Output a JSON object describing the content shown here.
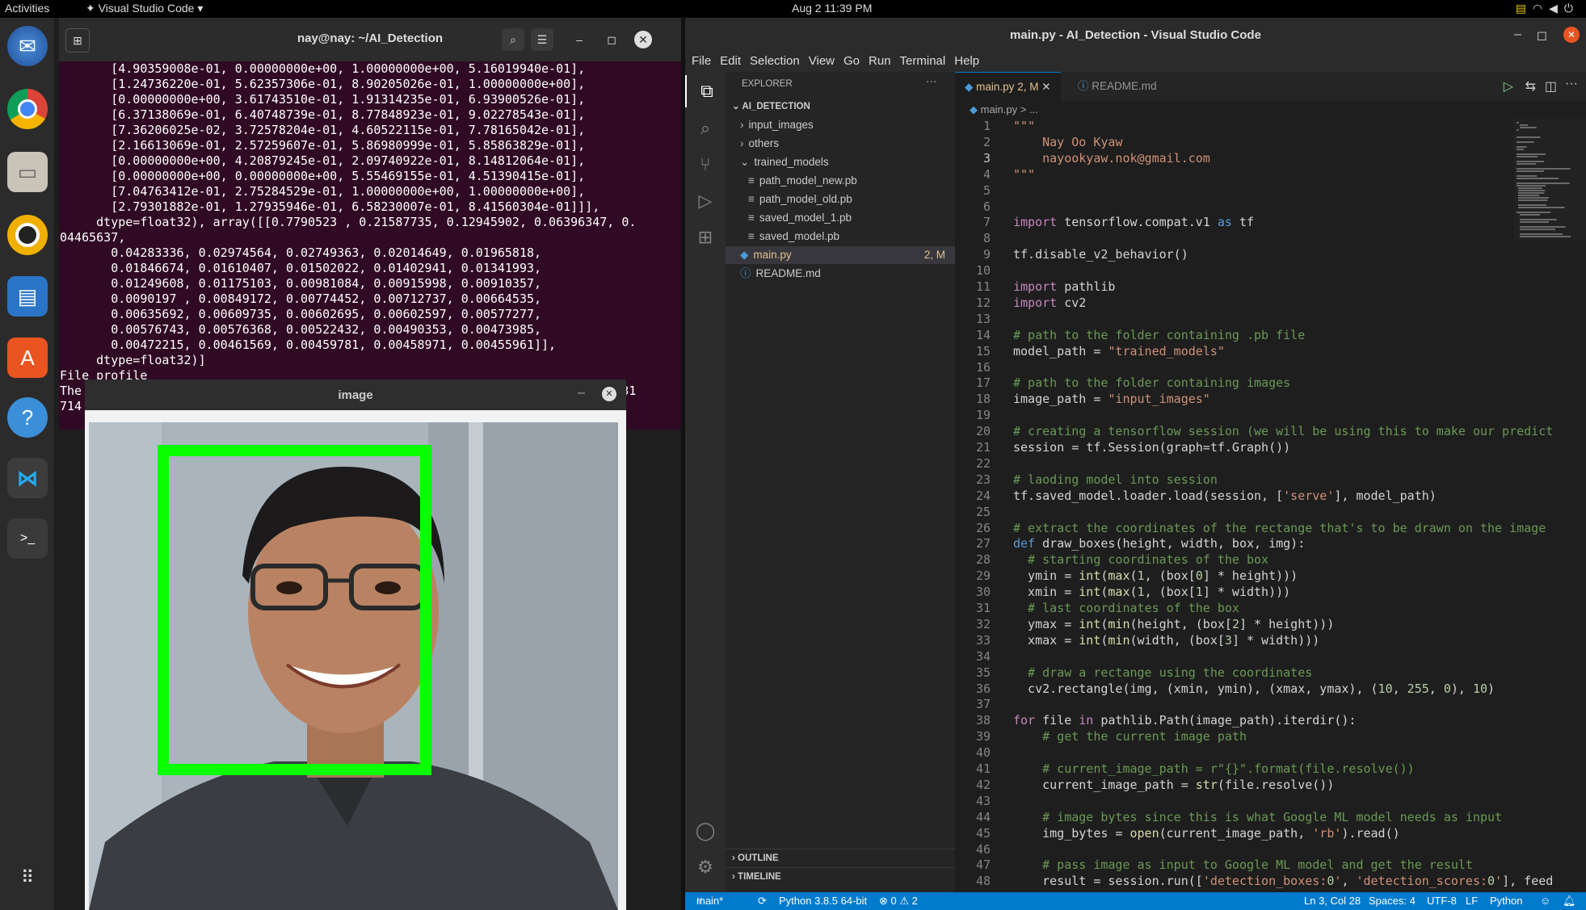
{
  "topbar": {
    "activities": "Activities",
    "app_name": "Visual Studio Code",
    "clock": "Aug 2  11:39 PM"
  },
  "terminal": {
    "title": "nay@nay: ~/AI_Detection",
    "lines": [
      "       [4.90359008e-01, 0.00000000e+00, 1.00000000e+00, 5.16019940e-01],",
      "       [1.24736220e-01, 5.62357306e-01, 8.90205026e-01, 1.00000000e+00],",
      "       [0.00000000e+00, 3.61743510e-01, 1.91314235e-01, 6.93900526e-01],",
      "       [6.37138069e-01, 6.40748739e-01, 8.77848923e-01, 9.02278543e-01],",
      "       [7.36206025e-02, 3.72578204e-01, 4.60522115e-01, 7.78165042e-01],",
      "       [2.16613069e-01, 2.57259607e-01, 5.86980999e-01, 5.85863829e-01],",
      "       [0.00000000e+00, 4.20879245e-01, 2.09740922e-01, 8.14812064e-01],",
      "       [0.00000000e+00, 0.00000000e+00, 5.55469155e-01, 4.51390415e-01],",
      "       [7.04763412e-01, 2.75284529e-01, 1.00000000e+00, 1.00000000e+00],",
      "       [2.79301882e-01, 1.27935946e-01, 6.58230007e-01, 8.41560304e-01]]],",
      "     dtype=float32), array([[0.7790523 , 0.21587735, 0.12945902, 0.06396347, 0.",
      "04465637,",
      "       0.04283336, 0.02974564, 0.02749363, 0.02014649, 0.01965818,",
      "       0.01846674, 0.01610407, 0.01502022, 0.01402941, 0.01341993,",
      "       0.01249608, 0.01175103, 0.00981084, 0.00915998, 0.00910357,",
      "       0.0090197 , 0.00849172, 0.00774452, 0.00712737, 0.00664535,",
      "       0.00635692, 0.00609735, 0.00602695, 0.00602597, 0.00577277,",
      "       0.00576743, 0.00576368, 0.00522432, 0.00490353, 0.00473985,",
      "       0.00472215, 0.00461569, 0.00459781, 0.00458971, 0.00455961]],",
      "     dtype=float32)]",
      "File profile",
      "The                                                                       05231",
      "714"
    ]
  },
  "image_window": {
    "title": "image"
  },
  "vscode": {
    "title": "main.py - AI_Detection - Visual Studio Code",
    "menu": [
      "File",
      "Edit",
      "Selection",
      "View",
      "Go",
      "Run",
      "Terminal",
      "Help"
    ],
    "explorer_label": "EXPLORER",
    "root": "AI_DETECTION",
    "tree": [
      {
        "label": "input_images",
        "kind": "folder",
        "badge": ""
      },
      {
        "label": "others",
        "kind": "folder",
        "badge": ""
      },
      {
        "label": "trained_models",
        "kind": "folder-open",
        "badge": ""
      },
      {
        "label": "path_model_new.pb",
        "kind": "file",
        "badge": ""
      },
      {
        "label": "path_model_old.pb",
        "kind": "file",
        "badge": ""
      },
      {
        "label": "saved_model_1.pb",
        "kind": "file",
        "badge": ""
      },
      {
        "label": "saved_model.pb",
        "kind": "file",
        "badge": ""
      },
      {
        "label": "main.py",
        "kind": "py",
        "badge": "2, M"
      },
      {
        "label": "README.md",
        "kind": "info",
        "badge": ""
      }
    ],
    "outline": "OUTLINE",
    "timeline": "TIMELINE",
    "tabs": [
      {
        "label": "main.py",
        "badge": "2, M"
      },
      {
        "label": "README.md",
        "badge": ""
      }
    ],
    "breadcrumb": "main.py > ...",
    "code": [
      "\"\"\"",
      "    Nay Oo Kyaw",
      "    nayookyaw.nok@gmail.com",
      "\"\"\"",
      "",
      "",
      "import tensorflow.compat.v1 as tf",
      "",
      "tf.disable_v2_behavior()",
      "",
      "import pathlib",
      "import cv2",
      "",
      "# path to the folder containing .pb file",
      "model_path = \"trained_models\"",
      "",
      "# path to the folder containing images",
      "image_path = \"input_images\"",
      "",
      "# creating a tensorflow session (we will be using this to make our predict",
      "session = tf.Session(graph=tf.Graph())",
      "",
      "# laoding model into session",
      "tf.saved_model.loader.load(session, ['serve'], model_path)",
      "",
      "# extract the coordinates of the rectange that's to be drawn on the image",
      "def draw_boxes(height, width, box, img):",
      "  # starting coordinates of the box",
      "  ymin = int(max(1, (box[0] * height)))",
      "  xmin = int(max(1, (box[1] * width)))",
      "  # last coordinates of the box",
      "  ymax = int(min(height, (box[2] * height)))",
      "  xmax = int(min(width, (box[3] * width)))",
      "",
      "  # draw a rectange using the coordinates",
      "  cv2.rectangle(img, (xmin, ymin), (xmax, ymax), (10, 255, 0), 10)",
      "",
      "for file in pathlib.Path(image_path).iterdir():",
      "    # get the current image path",
      "",
      "    # current_image_path = r\"{}\".format(file.resolve())",
      "    current_image_path = str(file.resolve())",
      "",
      "    # image bytes since this is what Google ML model needs as input",
      "    img_bytes = open(current_image_path, 'rb').read()",
      "",
      "    # pass image as input to Google ML model and get the result",
      "    result = session.run(['detection_boxes:0', 'detection_scores:0'], feed"
    ],
    "status": {
      "branch": "main*",
      "python": "Python 3.8.5 64-bit",
      "problems": "⊗ 0 ⚠ 2",
      "position": "Ln 3, Col 28",
      "spaces": "Spaces: 4",
      "encoding": "UTF-8",
      "eol": "LF",
      "language": "Python"
    }
  }
}
